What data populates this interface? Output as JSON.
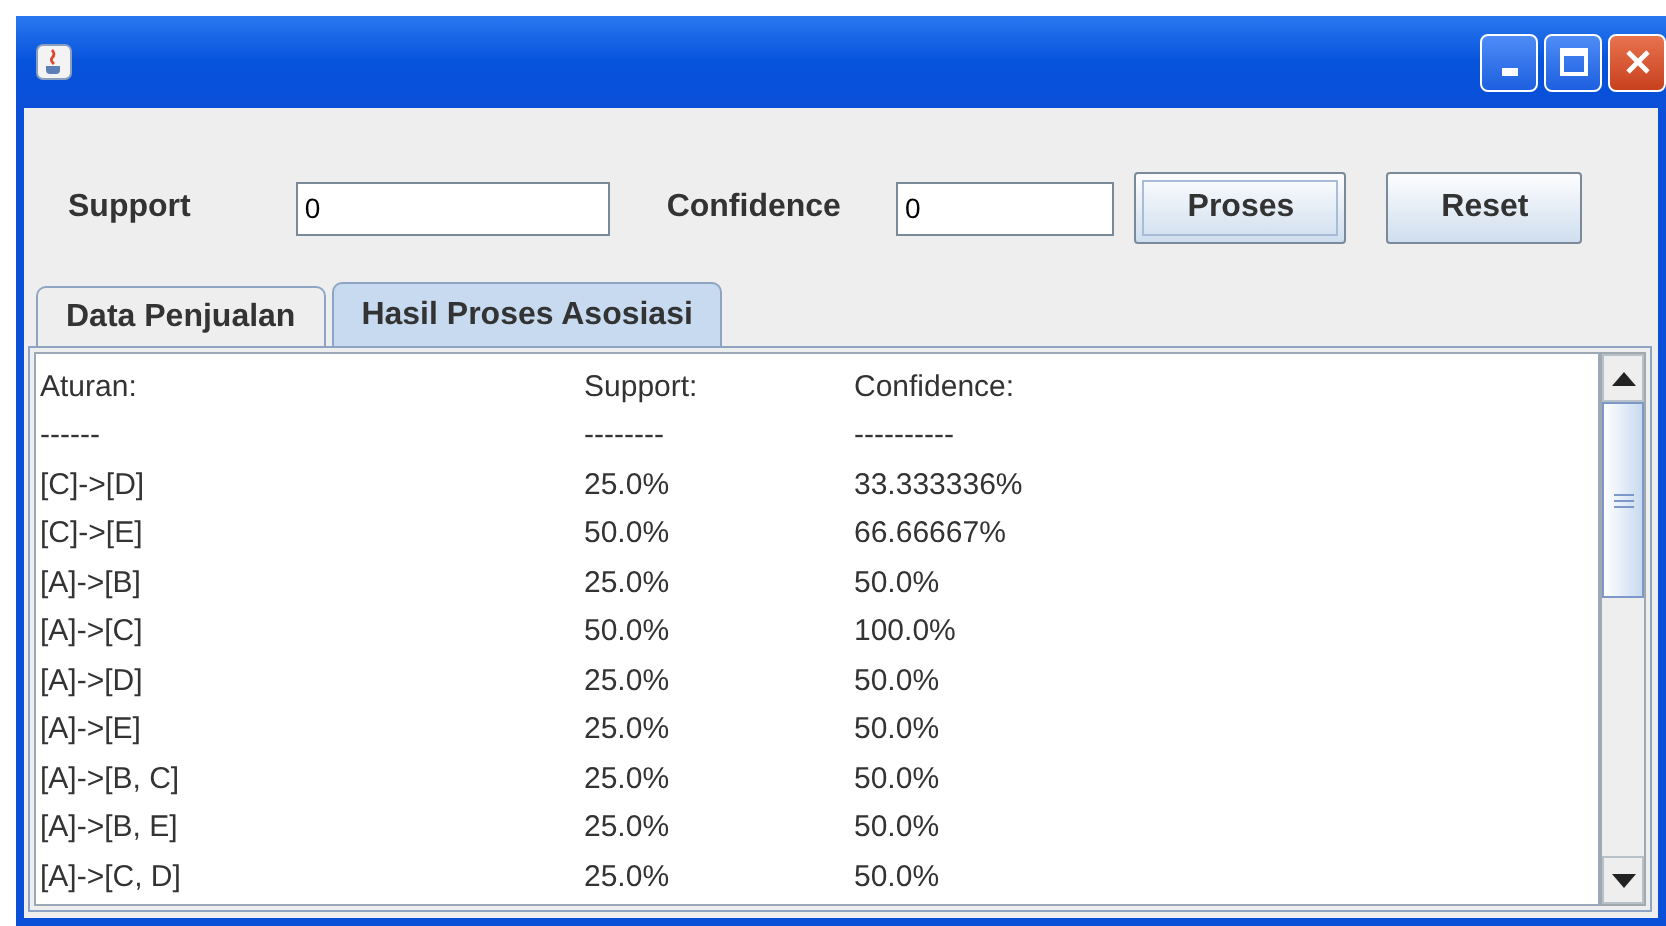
{
  "form": {
    "support_label": "Support",
    "support_value": "0",
    "confidence_label": "Confidence",
    "confidence_value": "0",
    "buttons": [
      {
        "label": "Proses",
        "focused": true
      },
      {
        "label": "Reset",
        "focused": false
      }
    ]
  },
  "tabs": [
    {
      "label": "Data Penjualan",
      "selected": false
    },
    {
      "label": "Hasil Proses Asosiasi",
      "selected": true
    }
  ],
  "output_lines": [
    [
      "Aturan:",
      "Support:",
      "Confidence:"
    ],
    [
      "------",
      "--------",
      "----------"
    ],
    [
      "[C]->[D]",
      "25.0%",
      "33.333336%"
    ],
    [
      "[C]->[E]",
      "50.0%",
      "66.66667%"
    ],
    [
      "[A]->[B]",
      "25.0%",
      "50.0%"
    ],
    [
      "[A]->[C]",
      "50.0%",
      "100.0%"
    ],
    [
      "[A]->[D]",
      "25.0%",
      "50.0%"
    ],
    [
      "[A]->[E]",
      "25.0%",
      "50.0%"
    ],
    [
      "[A]->[B, C]",
      "25.0%",
      "50.0%"
    ],
    [
      "[A]->[B, E]",
      "25.0%",
      "50.0%"
    ],
    [
      "[A]->[C, D]",
      "25.0%",
      "50.0%"
    ]
  ]
}
